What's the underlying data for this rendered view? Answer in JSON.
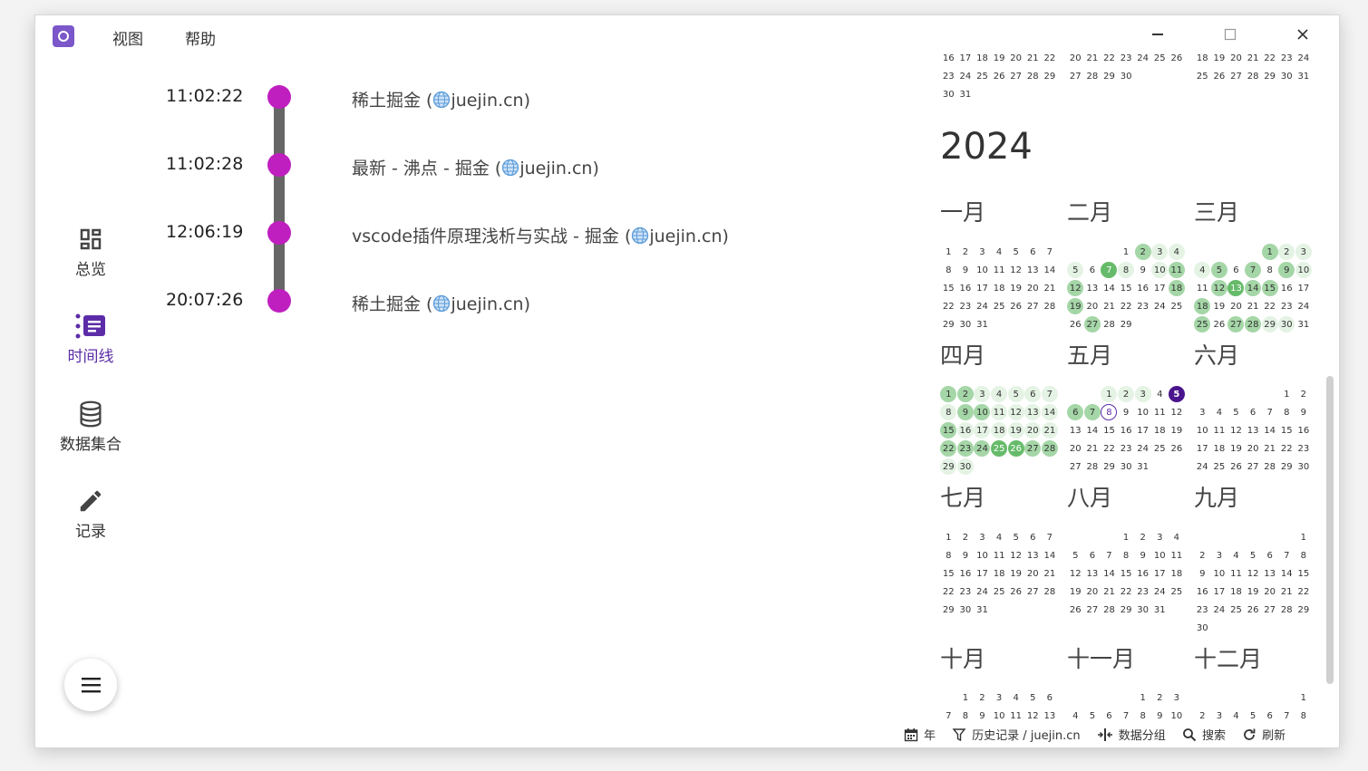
{
  "menubar": {
    "view": "视图",
    "help": "帮助"
  },
  "window_controls": {
    "minimize": "—",
    "maximize": "☐",
    "close": "✕"
  },
  "nav": [
    {
      "label": "总览",
      "icon": "dashboard-icon",
      "active": false
    },
    {
      "label": "时间线",
      "icon": "timeline-icon",
      "active": true
    },
    {
      "label": "数据集合",
      "icon": "database-icon",
      "active": false
    },
    {
      "label": "记录",
      "icon": "pencil-icon",
      "active": false
    }
  ],
  "timeline": [
    {
      "time": "11:02:22",
      "title": "稀土掘金 (",
      "domain": "juejin.cn)"
    },
    {
      "time": "11:02:28",
      "title": "最新 - 沸点 - 掘金 (",
      "domain": "juejin.cn)"
    },
    {
      "time": "12:06:19",
      "title": "vscode插件原理浅析与实战 - 掘金 (",
      "domain": "juejin.cn)"
    },
    {
      "time": "20:07:26",
      "title": "稀土掘金 (",
      "domain": "juejin.cn)"
    }
  ],
  "colors": {
    "accent": "#5c2ca8",
    "timeline_dot": "#c01fc0",
    "heat_low": "#e4f3e4",
    "heat_mid": "#a5d6a7",
    "heat_high": "#66bb6a",
    "selected": "#4a148c"
  },
  "calendar": {
    "prev_year_partial_rows": [
      [
        "16 17 18 19 20 21 22",
        "20 21 22 23 24 25 26",
        "18 19 20 21 22 23 24"
      ],
      [
        "23 24 25 26 27 28 29",
        "27 28 29 30",
        "25 26 27 28 29 30 31"
      ],
      [
        "30 31",
        "",
        ""
      ]
    ],
    "year": "2024",
    "months": [
      {
        "name": "一月",
        "start": 0,
        "days": 31,
        "heat": {}
      },
      {
        "name": "二月",
        "start": 3,
        "days": 29,
        "heat": {
          "2": 2,
          "3": 1,
          "4": 1,
          "5": 1,
          "7": 3,
          "8": 1,
          "10": 1,
          "11": 2,
          "12": 2,
          "18": 2,
          "19": 2,
          "27": 2
        }
      },
      {
        "name": "三月",
        "start": 4,
        "days": 31,
        "heat": {
          "1": 2,
          "2": 1,
          "3": 1,
          "4": 1,
          "5": 2,
          "7": 2,
          "9": 2,
          "10": 1,
          "12": 2,
          "13": 3,
          "14": 2,
          "15": 2,
          "18": 2,
          "25": 2,
          "27": 2,
          "28": 2,
          "29": 1,
          "30": 1
        }
      },
      {
        "name": "四月",
        "start": 0,
        "days": 30,
        "heat": {
          "1": 2,
          "2": 2,
          "3": 1,
          "4": 1,
          "5": 1,
          "6": 1,
          "7": 1,
          "8": 1,
          "9": 2,
          "10": 2,
          "11": 1,
          "12": 1,
          "13": 1,
          "14": 1,
          "15": 2,
          "16": 1,
          "17": 1,
          "18": 1,
          "19": 1,
          "20": 1,
          "21": 1,
          "22": 2,
          "23": 2,
          "24": 2,
          "25": 3,
          "26": 3,
          "27": 2,
          "28": 2,
          "29": 1,
          "30": 1
        }
      },
      {
        "name": "五月",
        "start": 2,
        "days": 31,
        "heat": {
          "1": 1,
          "2": 1,
          "3": 1,
          "6": 2,
          "7": 2
        },
        "today": 8,
        "selected": 5
      },
      {
        "name": "六月",
        "start": 5,
        "days": 30,
        "heat": {}
      },
      {
        "name": "七月",
        "start": 0,
        "days": 31,
        "heat": {}
      },
      {
        "name": "八月",
        "start": 3,
        "days": 31,
        "heat": {}
      },
      {
        "name": "九月",
        "start": 6,
        "days": 30,
        "heat": {}
      },
      {
        "name": "十月",
        "start": 1,
        "days": 31,
        "heat": {}
      },
      {
        "name": "十一月",
        "start": 4,
        "days": 30,
        "heat": {}
      },
      {
        "name": "十二月",
        "start": 6,
        "days": 31,
        "heat": {}
      }
    ]
  },
  "bottombar": {
    "year": "年",
    "filter": "历史记录 / juejin.cn",
    "group": "数据分组",
    "search": "搜索",
    "refresh": "刷新"
  }
}
